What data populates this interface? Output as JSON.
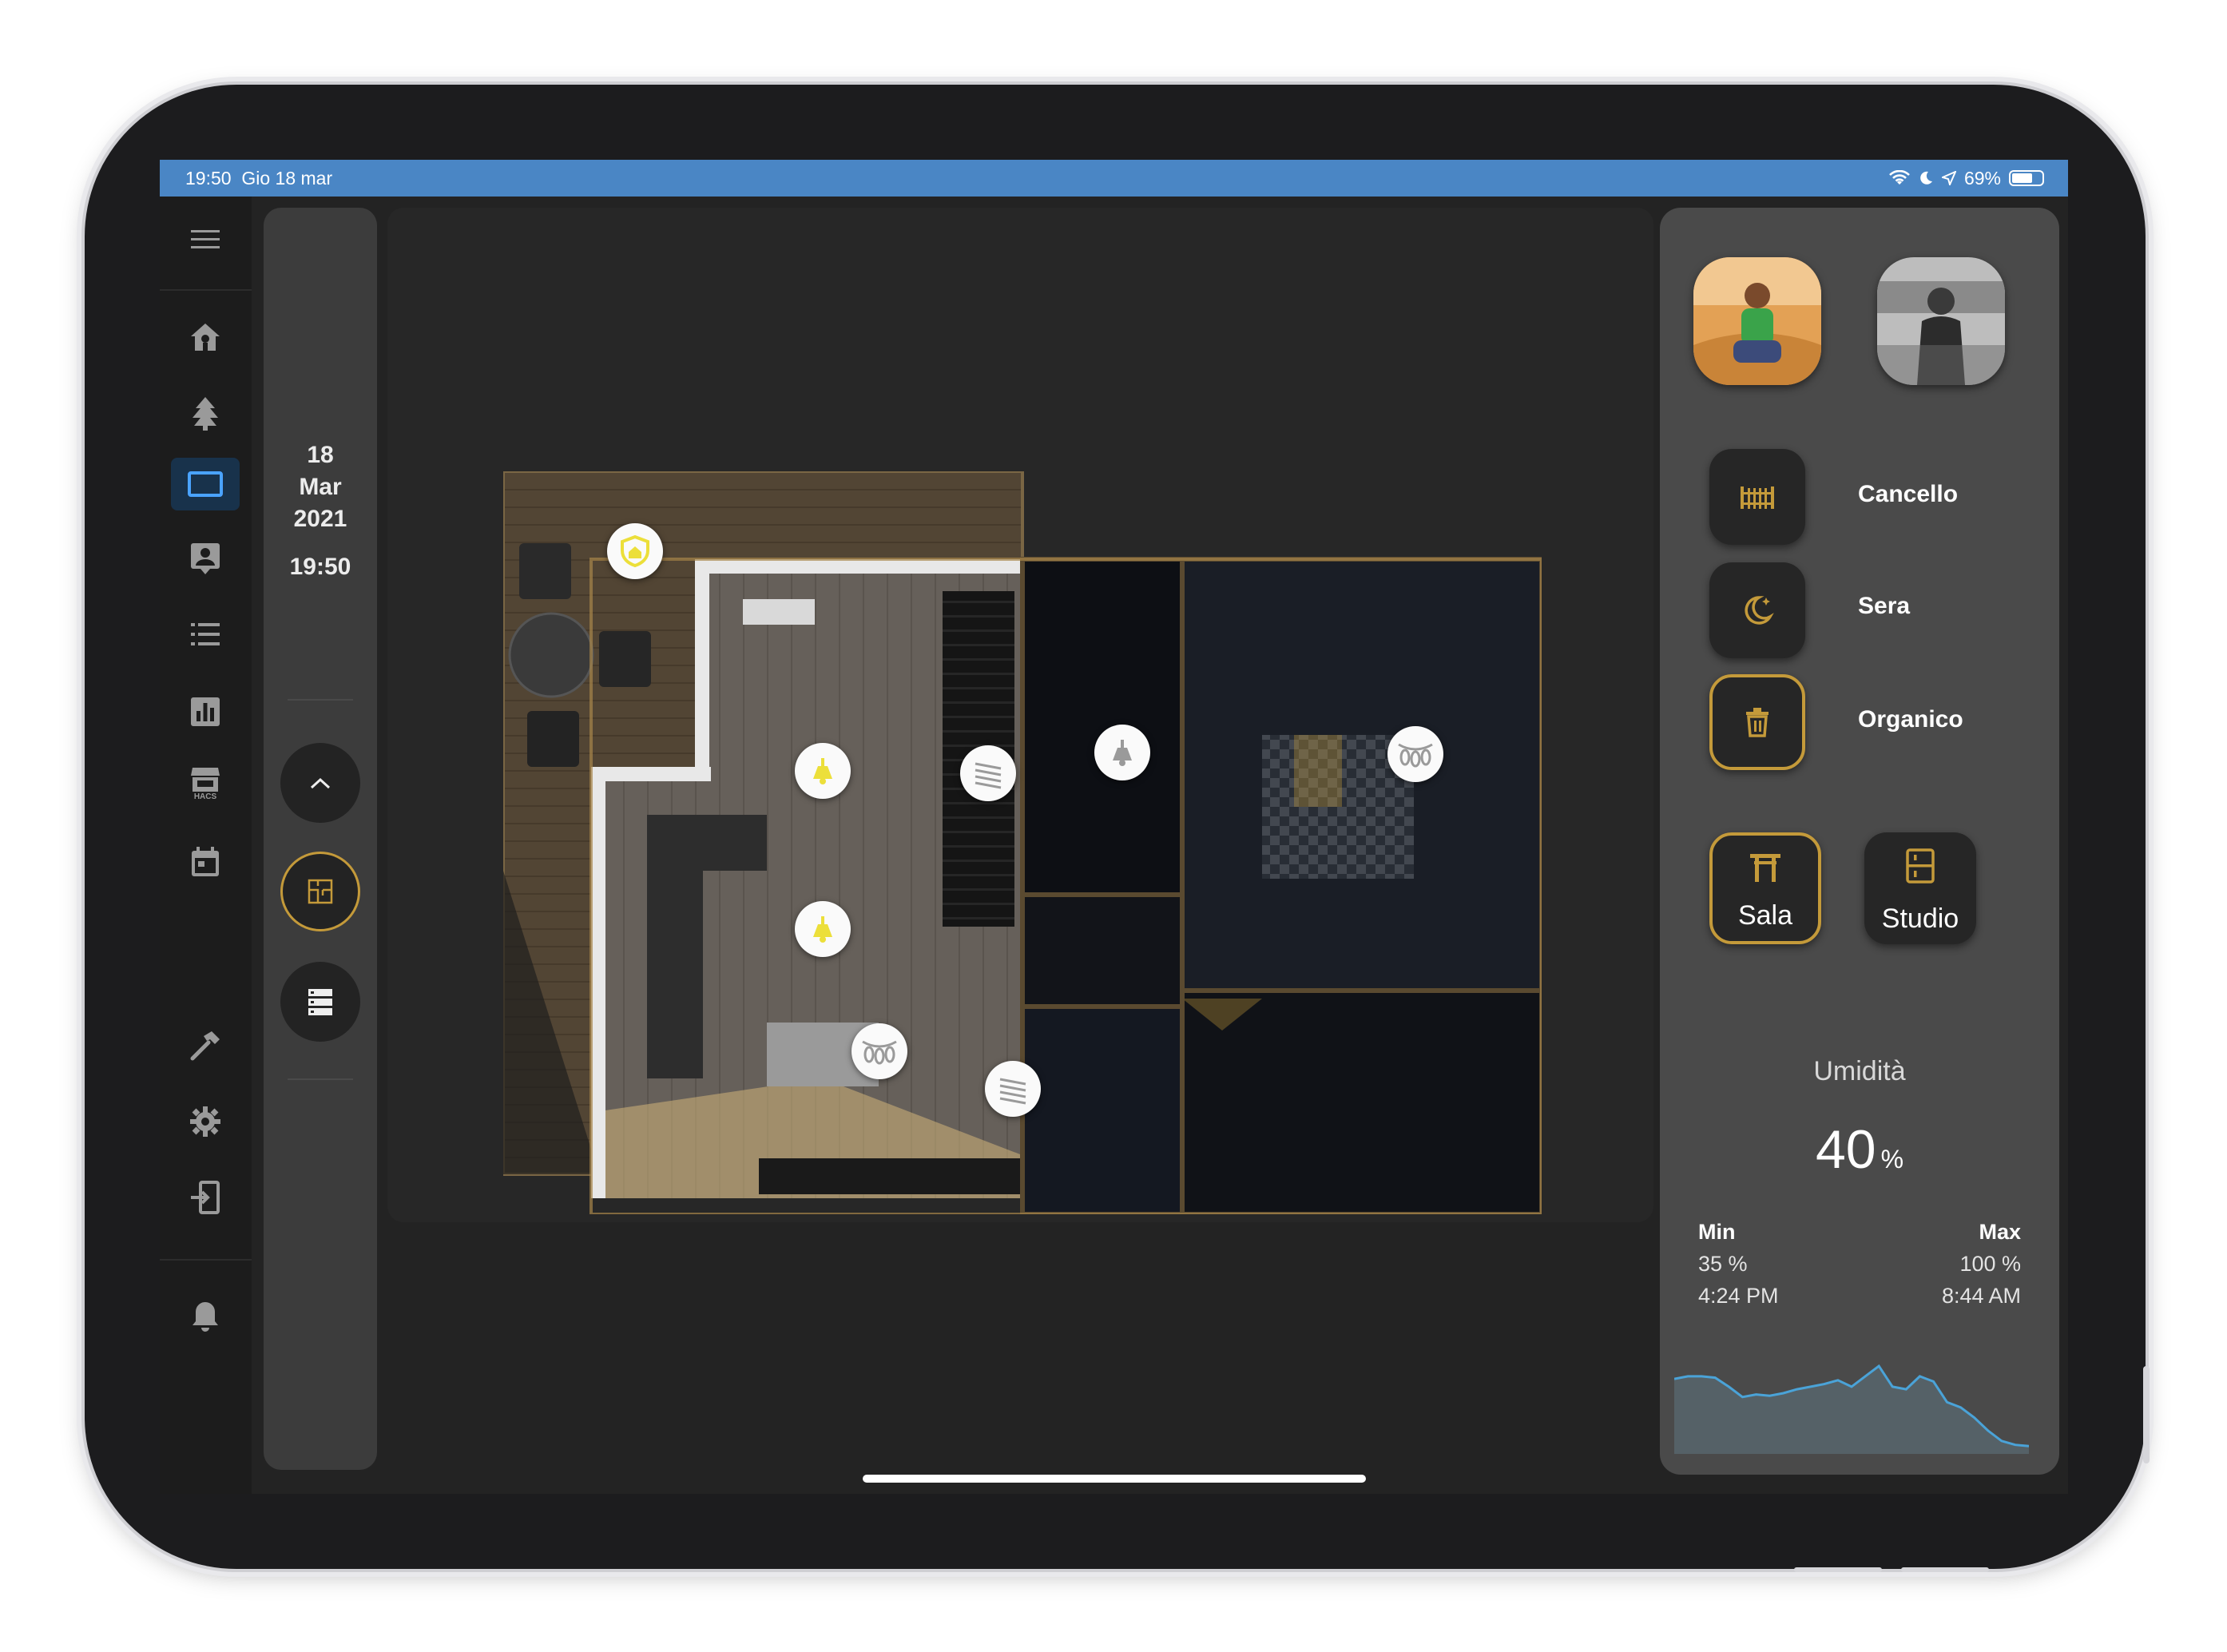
{
  "status_bar": {
    "time": "19:50",
    "date": "Gio 18 mar",
    "battery": "69%",
    "battery_level": 0.69
  },
  "ha_sidebar": {
    "items": [
      {
        "icon": "menu-icon"
      },
      {
        "icon": "home-outline-icon"
      },
      {
        "icon": "tree-icon"
      },
      {
        "icon": "floorplan-panel-icon",
        "active": true
      },
      {
        "icon": "account-box-icon"
      },
      {
        "icon": "format-list-icon"
      },
      {
        "icon": "chart-bar-icon"
      },
      {
        "icon": "hacs-store-icon"
      },
      {
        "icon": "calendar-icon"
      },
      {
        "icon": "hammer-icon"
      },
      {
        "icon": "gear-icon"
      },
      {
        "icon": "login-icon"
      },
      {
        "icon": "bell-icon"
      }
    ],
    "hacs_label": "HACS"
  },
  "date_panel": {
    "day": "18",
    "month": "Mar",
    "year": "2021",
    "time": "19:50"
  },
  "right_panel": {
    "scenes": [
      {
        "label": "Cancello",
        "icon": "gate-icon"
      },
      {
        "label": "Sera",
        "icon": "moon-star-icon"
      },
      {
        "label": "Organico",
        "icon": "trash-icon",
        "active": true
      }
    ],
    "rooms": [
      {
        "label": "Sala",
        "icon": "table-icon",
        "active": true
      },
      {
        "label": "Studio",
        "icon": "fridge-icon"
      }
    ],
    "humidity": {
      "title": "Umidità",
      "value": "40",
      "unit": "%",
      "min_label": "Min",
      "min_value": "35 %",
      "min_time": "4:24 PM",
      "max_label": "Max",
      "max_value": "100 %",
      "max_time": "8:44 AM",
      "history": [
        58,
        60,
        60,
        59,
        52,
        44,
        46,
        45,
        47,
        50,
        52,
        54,
        57,
        52,
        60,
        68,
        52,
        50,
        60,
        56,
        40,
        36,
        28,
        18,
        10,
        7,
        6
      ]
    }
  },
  "colors": {
    "accent_gold": "#c49a3a",
    "status_bar": "#4a86c5",
    "sidebar_active": "#4aa3ff"
  }
}
